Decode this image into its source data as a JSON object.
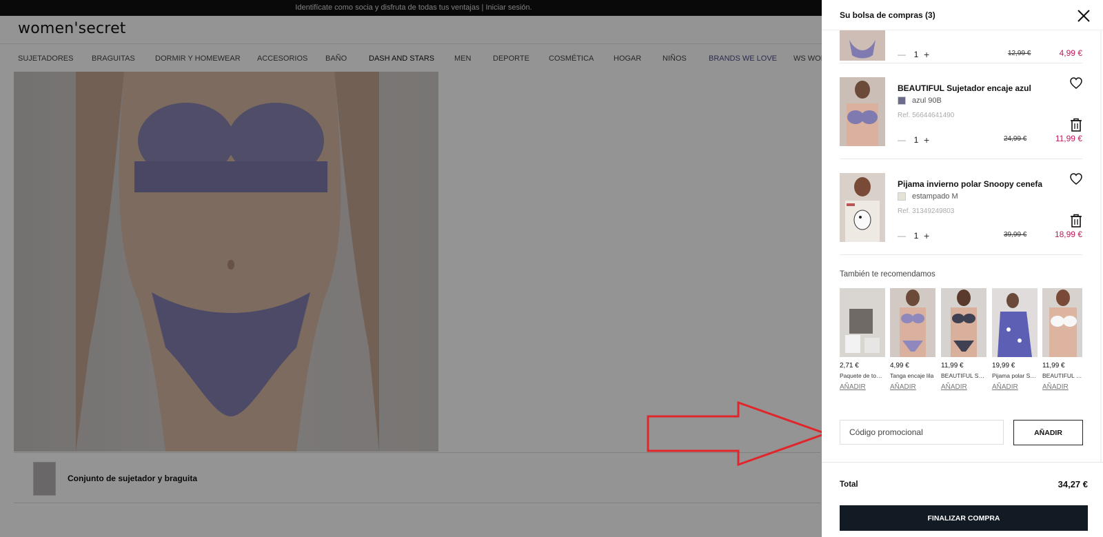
{
  "promo_bar": {
    "text": "Identifícate como socia y disfruta de todas tus ventajas | Iniciar sesión."
  },
  "header": {
    "logo": "women'secret"
  },
  "nav": [
    {
      "label": "SUJETADORES"
    },
    {
      "label": "BRAGUITAS"
    },
    {
      "label": "DORMIR Y HOMEWEAR"
    },
    {
      "label": "ACCESORIOS"
    },
    {
      "label": "BAÑO"
    },
    {
      "label": "DASH AND STARS"
    },
    {
      "label": "MEN"
    },
    {
      "label": "DEPORTE"
    },
    {
      "label": "COSMÉTICA"
    },
    {
      "label": "HOGAR"
    },
    {
      "label": "NIÑOS"
    },
    {
      "label": "BRANDS WE LOVE"
    },
    {
      "label": "WS WOR"
    }
  ],
  "product_strip": {
    "title": "Conjunto de sujetador y braguita"
  },
  "cart": {
    "title": "Su bolsa de compras (3)",
    "items": [
      {
        "name": "",
        "variant": "",
        "ref": "",
        "qty": "1",
        "old_price": "12,99 €",
        "price": "4,99 €",
        "swatch_color": "#7a7aa6"
      },
      {
        "name": "BEAUTIFUL Sujetador encaje azul",
        "variant": "azul 90B",
        "ref": "Ref. 56644641490",
        "qty": "1",
        "old_price": "24,99 €",
        "price": "11,99 €",
        "swatch_color": "#6b6b8c"
      },
      {
        "name": "Pijama invierno polar Snoopy cenefa",
        "variant": "estampado M",
        "ref": "Ref. 31349249803",
        "qty": "1",
        "old_price": "39,99 €",
        "price": "18,99 €",
        "swatch_color": "#e7e2d6"
      }
    ],
    "reco_title": "También te recomendamos",
    "recommendations": [
      {
        "price": "2,71 €",
        "name": "Paquete de toall...",
        "add": "AÑADIR"
      },
      {
        "price": "4,99 €",
        "name": "Tanga encaje lila",
        "add": "AÑADIR"
      },
      {
        "price": "11,99 €",
        "name": "BEAUTIFUL Suje...",
        "add": "AÑADIR"
      },
      {
        "price": "19,99 €",
        "name": "Pijama polar Sn...",
        "add": "AÑADIR"
      },
      {
        "price": "11,99 €",
        "name": "BEAUTIFUL Suj",
        "add": "AÑADIR"
      }
    ],
    "promo": {
      "placeholder": "Código promocional",
      "button": "AÑADIR"
    },
    "total_label": "Total",
    "total_value": "34,27 €",
    "checkout": "FINALIZAR COMPRA"
  },
  "colors": {
    "sale_price": "#c2185b",
    "checkout_bg": "#121a24",
    "arrow": "#e0262b"
  }
}
